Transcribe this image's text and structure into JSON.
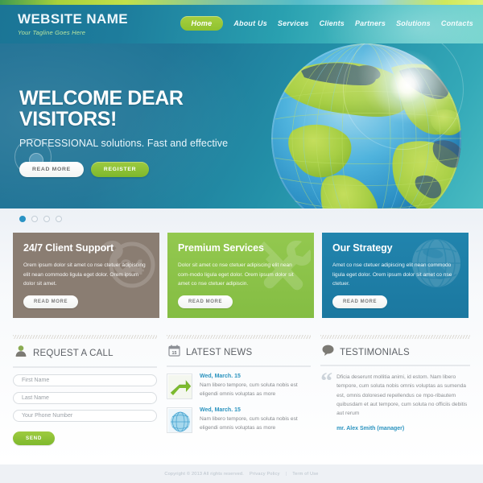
{
  "theme": {
    "accent_green": "#8fc22f",
    "accent_blue": "#1e7fa8",
    "brown": "#8a7d72",
    "link_blue": "#2a93bf"
  },
  "header": {
    "brand_name": "WEBSITE NAME",
    "tagline": "Your Tagline Goes Here",
    "nav": [
      {
        "label": "Home",
        "active": true
      },
      {
        "label": "About Us",
        "active": false
      },
      {
        "label": "Services",
        "active": false
      },
      {
        "label": "Clients",
        "active": false
      },
      {
        "label": "Partners",
        "active": false
      },
      {
        "label": "Solutions",
        "active": false
      },
      {
        "label": "Contacts",
        "active": false
      }
    ]
  },
  "hero": {
    "title": "WELCOME DEAR VISITORS!",
    "subtitle": "PROFESSIONAL solutions. Fast and effective",
    "primary_button": "READ MORE",
    "secondary_button": "REGISTER",
    "slider_dots": 4,
    "active_dot": 1
  },
  "boxes": [
    {
      "title": "24/7 Client Support",
      "text": "Orem ipsum dolor sit amet co nse ctetuer adipiscing elit nean commodo ligula eget dolor. Orem ipsum dolor sit amet.",
      "button": "READ MORE",
      "color": "#8a7d72",
      "watermark": "support-24-icon"
    },
    {
      "title": "Premium Services",
      "text": "Dolor sit amet co nse ctetuer adipiscing elit nean com-modo ligula eget dolor. Orem ipsum dolor sit amet co nse ctetuer adipiscin.",
      "button": "READ MORE",
      "color": "#8bc34a",
      "watermark": "tools-icon"
    },
    {
      "title": "Our Strategy",
      "text": "Amet co nse ctetuer adipiscing elit nean commodo ligula eget dolor. Orem ipsum dolor sit amet co nse ctetuer.",
      "button": "READ MORE",
      "color": "#1e7fa8",
      "watermark": "globe-icon"
    }
  ],
  "request_call": {
    "title": "REQUEST A CALL",
    "icon": "person-icon",
    "fields": [
      {
        "placeholder": "First Name"
      },
      {
        "placeholder": "Last Name"
      },
      {
        "placeholder": "Your Phone Number"
      }
    ],
    "submit": "SEND"
  },
  "latest_news": {
    "title": "LATEST NEWS",
    "icon": "calendar-icon",
    "calendar_day": "15",
    "items": [
      {
        "date": "Wed, March. 15",
        "text": "Nam libero tempore, cum soluta nobis est eligendi omnis voluptas as more",
        "thumb": "green-arrow-icon"
      },
      {
        "date": "Wed, March. 15",
        "text": "Nam libero tempore, cum soluta nobis est eligendi omnis voluptas as more",
        "thumb": "wire-globe-icon"
      }
    ]
  },
  "testimonials": {
    "title": "TESTIMONIALS",
    "icon": "speech-bubble-icon",
    "quote": "Dficia deserunt mollitia animi, id estom. Nam libero tempore, cum soluta nobis omnis voluptas as sumenda est, omnis doloresed repellendus ce mpo-ribautem quibusdam et aut tempore, cum soluta no officiis debitis aut rerum",
    "author": "mr. Alex Smith (manager)"
  },
  "footer": {
    "copyright": "Copyright © 2013  All rights reserved.",
    "privacy": "Privacy Policy",
    "separator": "|",
    "terms": "Term of Use"
  }
}
